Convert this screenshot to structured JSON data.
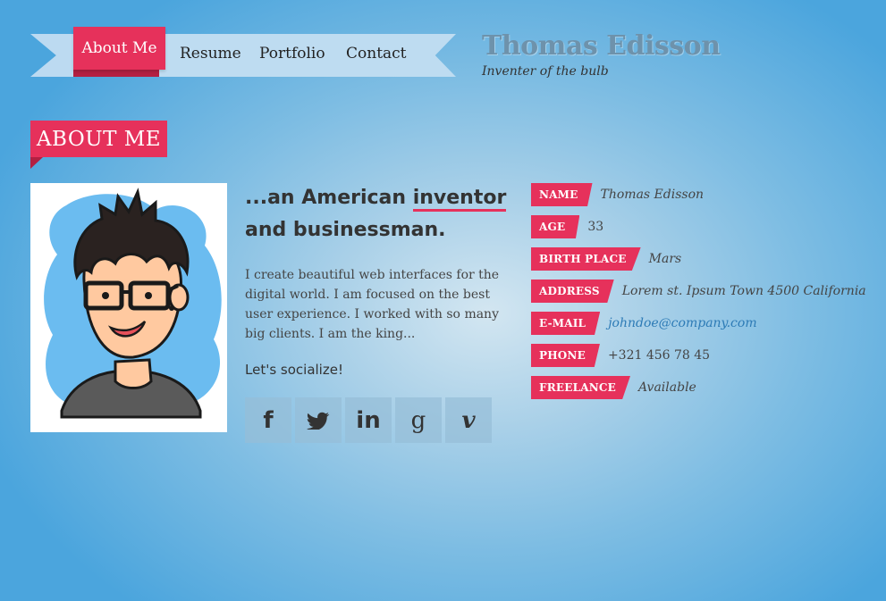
{
  "nav": {
    "items": [
      {
        "label": "About Me",
        "active": true
      },
      {
        "label": "Resume"
      },
      {
        "label": "Portfolio"
      },
      {
        "label": "Contact"
      }
    ]
  },
  "site": {
    "name": "Thomas Edisson",
    "tagline": "Inventer of the bulb"
  },
  "section": {
    "title": "ABOUT ME"
  },
  "intro": {
    "headline_pre": "...an American ",
    "headline_highlight": "inventor",
    "headline_post": " and businessman.",
    "bio": "I create beautiful web interfaces for the digital world. I am focused on the best user experience. I worked with so many big clients. I am the king...",
    "socialize": "Let's socialize!"
  },
  "social": [
    {
      "name": "facebook",
      "glyph": "f"
    },
    {
      "name": "twitter",
      "glyph": ""
    },
    {
      "name": "linkedin",
      "glyph": "in"
    },
    {
      "name": "google",
      "glyph": "g"
    },
    {
      "name": "vimeo",
      "glyph": "v"
    }
  ],
  "info": [
    {
      "label": "NAME",
      "value": "Thomas Edisson"
    },
    {
      "label": "AGE",
      "value": "33"
    },
    {
      "label": "BIRTH PLACE",
      "value": "Mars"
    },
    {
      "label": "ADDRESS",
      "value": "Lorem st. Ipsum Town 4500 California"
    },
    {
      "label": "E-MAIL",
      "value": "johndoe@company.com"
    },
    {
      "label": "PHONE",
      "value": "+321 456 78 45"
    },
    {
      "label": "FREELANCE",
      "value": "Available"
    }
  ],
  "colors": {
    "accent": "#e6315b",
    "accent_dark": "#b32042",
    "ribbon": "#bedcf1",
    "link": "#2d7bb6"
  }
}
